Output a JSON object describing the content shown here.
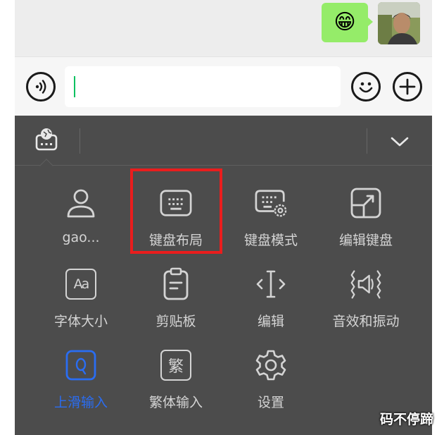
{
  "chat": {
    "bubble_emoji": "😁"
  },
  "keyboard_panel": {
    "tiles": [
      {
        "label": "gao...",
        "icon": "person-icon"
      },
      {
        "label": "键盘布局",
        "icon": "keyboard-layout-icon"
      },
      {
        "label": "键盘模式",
        "icon": "keyboard-settings-icon"
      },
      {
        "label": "编辑键盘",
        "icon": "edit-keyboard-icon"
      },
      {
        "label": "字体大小",
        "icon": "font-size-icon"
      },
      {
        "label": "剪贴板",
        "icon": "clipboard-icon"
      },
      {
        "label": "编辑",
        "icon": "text-cursor-icon"
      },
      {
        "label": "音效和振动",
        "icon": "sound-vibration-icon"
      },
      {
        "label": "上滑输入",
        "icon": "swipe-input-icon"
      },
      {
        "label": "繁体输入",
        "icon": "traditional-chinese-icon"
      },
      {
        "label": "设置",
        "icon": "settings-gear-icon"
      }
    ],
    "traditional_glyph": "繁",
    "font_size_glyph": "Aa"
  },
  "watermark": "码不停蹄",
  "colors": {
    "bubble": "#95ec69",
    "panel_bg": "#4c4c4c",
    "icon_stroke": "#d4d4d4",
    "active_blue": "#2a6df2",
    "highlight_red": "#ea1d1d",
    "caret_green": "#07c160"
  }
}
